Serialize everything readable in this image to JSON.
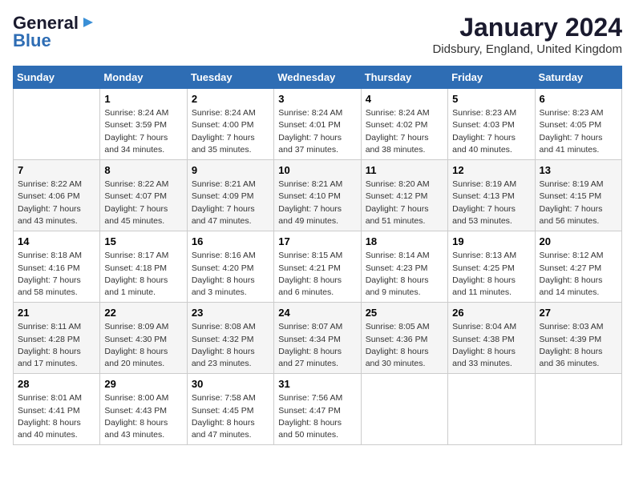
{
  "header": {
    "logo_line1": "General",
    "logo_line2": "Blue",
    "month_title": "January 2024",
    "location": "Didsbury, England, United Kingdom"
  },
  "days_of_week": [
    "Sunday",
    "Monday",
    "Tuesday",
    "Wednesday",
    "Thursday",
    "Friday",
    "Saturday"
  ],
  "weeks": [
    [
      {
        "date": "",
        "sunrise": "",
        "sunset": "",
        "daylight": ""
      },
      {
        "date": "1",
        "sunrise": "Sunrise: 8:24 AM",
        "sunset": "Sunset: 3:59 PM",
        "daylight": "Daylight: 7 hours and 34 minutes."
      },
      {
        "date": "2",
        "sunrise": "Sunrise: 8:24 AM",
        "sunset": "Sunset: 4:00 PM",
        "daylight": "Daylight: 7 hours and 35 minutes."
      },
      {
        "date": "3",
        "sunrise": "Sunrise: 8:24 AM",
        "sunset": "Sunset: 4:01 PM",
        "daylight": "Daylight: 7 hours and 37 minutes."
      },
      {
        "date": "4",
        "sunrise": "Sunrise: 8:24 AM",
        "sunset": "Sunset: 4:02 PM",
        "daylight": "Daylight: 7 hours and 38 minutes."
      },
      {
        "date": "5",
        "sunrise": "Sunrise: 8:23 AM",
        "sunset": "Sunset: 4:03 PM",
        "daylight": "Daylight: 7 hours and 40 minutes."
      },
      {
        "date": "6",
        "sunrise": "Sunrise: 8:23 AM",
        "sunset": "Sunset: 4:05 PM",
        "daylight": "Daylight: 7 hours and 41 minutes."
      }
    ],
    [
      {
        "date": "7",
        "sunrise": "Sunrise: 8:22 AM",
        "sunset": "Sunset: 4:06 PM",
        "daylight": "Daylight: 7 hours and 43 minutes."
      },
      {
        "date": "8",
        "sunrise": "Sunrise: 8:22 AM",
        "sunset": "Sunset: 4:07 PM",
        "daylight": "Daylight: 7 hours and 45 minutes."
      },
      {
        "date": "9",
        "sunrise": "Sunrise: 8:21 AM",
        "sunset": "Sunset: 4:09 PM",
        "daylight": "Daylight: 7 hours and 47 minutes."
      },
      {
        "date": "10",
        "sunrise": "Sunrise: 8:21 AM",
        "sunset": "Sunset: 4:10 PM",
        "daylight": "Daylight: 7 hours and 49 minutes."
      },
      {
        "date": "11",
        "sunrise": "Sunrise: 8:20 AM",
        "sunset": "Sunset: 4:12 PM",
        "daylight": "Daylight: 7 hours and 51 minutes."
      },
      {
        "date": "12",
        "sunrise": "Sunrise: 8:19 AM",
        "sunset": "Sunset: 4:13 PM",
        "daylight": "Daylight: 7 hours and 53 minutes."
      },
      {
        "date": "13",
        "sunrise": "Sunrise: 8:19 AM",
        "sunset": "Sunset: 4:15 PM",
        "daylight": "Daylight: 7 hours and 56 minutes."
      }
    ],
    [
      {
        "date": "14",
        "sunrise": "Sunrise: 8:18 AM",
        "sunset": "Sunset: 4:16 PM",
        "daylight": "Daylight: 7 hours and 58 minutes."
      },
      {
        "date": "15",
        "sunrise": "Sunrise: 8:17 AM",
        "sunset": "Sunset: 4:18 PM",
        "daylight": "Daylight: 8 hours and 1 minute."
      },
      {
        "date": "16",
        "sunrise": "Sunrise: 8:16 AM",
        "sunset": "Sunset: 4:20 PM",
        "daylight": "Daylight: 8 hours and 3 minutes."
      },
      {
        "date": "17",
        "sunrise": "Sunrise: 8:15 AM",
        "sunset": "Sunset: 4:21 PM",
        "daylight": "Daylight: 8 hours and 6 minutes."
      },
      {
        "date": "18",
        "sunrise": "Sunrise: 8:14 AM",
        "sunset": "Sunset: 4:23 PM",
        "daylight": "Daylight: 8 hours and 9 minutes."
      },
      {
        "date": "19",
        "sunrise": "Sunrise: 8:13 AM",
        "sunset": "Sunset: 4:25 PM",
        "daylight": "Daylight: 8 hours and 11 minutes."
      },
      {
        "date": "20",
        "sunrise": "Sunrise: 8:12 AM",
        "sunset": "Sunset: 4:27 PM",
        "daylight": "Daylight: 8 hours and 14 minutes."
      }
    ],
    [
      {
        "date": "21",
        "sunrise": "Sunrise: 8:11 AM",
        "sunset": "Sunset: 4:28 PM",
        "daylight": "Daylight: 8 hours and 17 minutes."
      },
      {
        "date": "22",
        "sunrise": "Sunrise: 8:09 AM",
        "sunset": "Sunset: 4:30 PM",
        "daylight": "Daylight: 8 hours and 20 minutes."
      },
      {
        "date": "23",
        "sunrise": "Sunrise: 8:08 AM",
        "sunset": "Sunset: 4:32 PM",
        "daylight": "Daylight: 8 hours and 23 minutes."
      },
      {
        "date": "24",
        "sunrise": "Sunrise: 8:07 AM",
        "sunset": "Sunset: 4:34 PM",
        "daylight": "Daylight: 8 hours and 27 minutes."
      },
      {
        "date": "25",
        "sunrise": "Sunrise: 8:05 AM",
        "sunset": "Sunset: 4:36 PM",
        "daylight": "Daylight: 8 hours and 30 minutes."
      },
      {
        "date": "26",
        "sunrise": "Sunrise: 8:04 AM",
        "sunset": "Sunset: 4:38 PM",
        "daylight": "Daylight: 8 hours and 33 minutes."
      },
      {
        "date": "27",
        "sunrise": "Sunrise: 8:03 AM",
        "sunset": "Sunset: 4:39 PM",
        "daylight": "Daylight: 8 hours and 36 minutes."
      }
    ],
    [
      {
        "date": "28",
        "sunrise": "Sunrise: 8:01 AM",
        "sunset": "Sunset: 4:41 PM",
        "daylight": "Daylight: 8 hours and 40 minutes."
      },
      {
        "date": "29",
        "sunrise": "Sunrise: 8:00 AM",
        "sunset": "Sunset: 4:43 PM",
        "daylight": "Daylight: 8 hours and 43 minutes."
      },
      {
        "date": "30",
        "sunrise": "Sunrise: 7:58 AM",
        "sunset": "Sunset: 4:45 PM",
        "daylight": "Daylight: 8 hours and 47 minutes."
      },
      {
        "date": "31",
        "sunrise": "Sunrise: 7:56 AM",
        "sunset": "Sunset: 4:47 PM",
        "daylight": "Daylight: 8 hours and 50 minutes."
      },
      {
        "date": "",
        "sunrise": "",
        "sunset": "",
        "daylight": ""
      },
      {
        "date": "",
        "sunrise": "",
        "sunset": "",
        "daylight": ""
      },
      {
        "date": "",
        "sunrise": "",
        "sunset": "",
        "daylight": ""
      }
    ]
  ]
}
